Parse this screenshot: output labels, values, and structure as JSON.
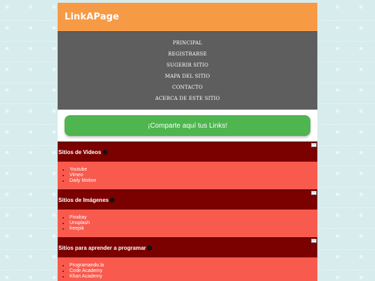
{
  "header": {
    "logo": "LinkAPage"
  },
  "nav": {
    "items": [
      "PRINCIPAL",
      "REGISTRARSE",
      "SUGERIR SITIO",
      "MAPA DEL SITIO",
      "CONTACTO",
      "ACERCA DE ESTE SITIO"
    ]
  },
  "share": {
    "label": "¡Comparte aquí tus Links!"
  },
  "categories": [
    {
      "title": "Sitios de Videos",
      "links": [
        "Youtube",
        "Vimeo",
        "Daily Motion"
      ]
    },
    {
      "title": "Sitios de Imágenes",
      "links": [
        "Pixabay",
        "Unsplash",
        "freepik"
      ]
    },
    {
      "title": "Sitios para aprender a programar",
      "links": [
        "Programando.la",
        "Code Academy",
        "Khan Academy"
      ]
    }
  ],
  "colors": {
    "header_bg": "#f79a45",
    "nav_bg": "#5e5e5e",
    "share_bg": "#4eb54f",
    "category_header_bg": "#7b0000",
    "category_body_bg": "#f85a4e"
  }
}
